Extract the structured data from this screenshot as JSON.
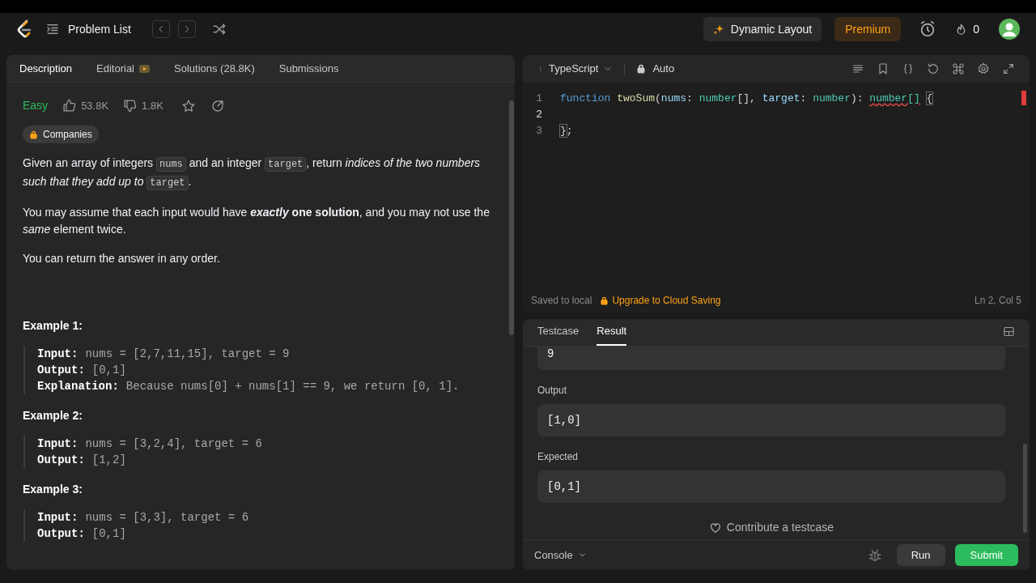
{
  "nav": {
    "title": "Problem List",
    "dynamic_layout": "Dynamic Layout",
    "premium": "Premium",
    "streak": "0"
  },
  "left_tabs": [
    {
      "label": "Description",
      "selected": true,
      "kind": "plain"
    },
    {
      "label": "Editorial",
      "selected": false,
      "kind": "video"
    },
    {
      "label": "Solutions (28.8K)",
      "selected": false,
      "kind": "plain"
    },
    {
      "label": "Submissions",
      "selected": false,
      "kind": "plain"
    }
  ],
  "problem": {
    "difficulty": "Easy",
    "likes": "53.8K",
    "dislikes": "1.8K",
    "companies": "Companies",
    "paragraphs": [
      [
        {
          "kind": "text",
          "text": "Given an array of integers "
        },
        {
          "kind": "code",
          "text": "nums"
        },
        {
          "kind": "text",
          "text": " and an integer "
        },
        {
          "kind": "code",
          "text": "target"
        },
        {
          "kind": "text",
          "text": ", return *indices of the two numbers such that they add up to* "
        },
        {
          "kind": "code",
          "text": "target"
        },
        {
          "kind": "text",
          "text": "."
        }
      ],
      [
        {
          "kind": "text",
          "text": "You may assume that each input would have ***exactly* one solution**, and you may not use the *same* element twice."
        }
      ],
      [
        {
          "kind": "text",
          "text": "You can return the answer in any order."
        }
      ]
    ],
    "examples": [
      {
        "title": "Example 1:",
        "lines": [
          {
            "label": "Input:",
            "value": "nums = [2,7,11,15], target = 9"
          },
          {
            "label": "Output:",
            "value": "[0,1]"
          },
          {
            "label": "Explanation:",
            "value": "Because nums[0] + nums[1] == 9, we return [0, 1]."
          }
        ]
      },
      {
        "title": "Example 2:",
        "lines": [
          {
            "label": "Input:",
            "value": "nums = [3,2,4], target = 6"
          },
          {
            "label": "Output:",
            "value": "[1,2]"
          }
        ]
      },
      {
        "title": "Example 3:",
        "lines": [
          {
            "label": "Input:",
            "value": "nums = [3,3], target = 6"
          },
          {
            "label": "Output:",
            "value": "[0,1]"
          }
        ]
      }
    ]
  },
  "editor": {
    "language": "TypeScript",
    "mode": "Auto",
    "lines": [
      {
        "number": "1",
        "tokens": [
          {
            "kind": "keyword",
            "text": "function"
          },
          {
            "kind": "function",
            "text": "twoSum"
          },
          {
            "kind": "plain",
            "text": "("
          },
          {
            "kind": "param",
            "text": "nums"
          },
          {
            "kind": "plain",
            "text": ": "
          },
          {
            "kind": "type",
            "text": "number"
          },
          {
            "kind": "plain",
            "text": "[], "
          },
          {
            "kind": "param",
            "text": "target"
          },
          {
            "kind": "plain",
            "text": ": "
          },
          {
            "kind": "type",
            "text": "number"
          },
          {
            "kind": "plain",
            "text": "): "
          },
          {
            "kind": "error",
            "text": "number[]"
          },
          {
            "kind": "bracket",
            "text": "{"
          }
        ]
      },
      {
        "number": "2"
      },
      {
        "number": "3",
        "tokens": [
          {
            "kind": "bracket",
            "text": "}"
          },
          {
            "kind": "plain",
            "text": ";"
          }
        ]
      }
    ],
    "saved": "Saved to local",
    "upgrade": "Upgrade to Cloud Saving",
    "cursor": "Ln 2, Col 5"
  },
  "bottom_tabs": [
    {
      "label": "Testcase",
      "selected": false
    },
    {
      "label": "Result",
      "selected": true
    }
  ],
  "result": {
    "partial_value": "9",
    "fields": [
      {
        "label": "Output",
        "value": "[1,0]"
      },
      {
        "label": "Expected",
        "value": "[0,1]"
      }
    ],
    "contribute": "Contribute a testcase"
  },
  "footer": {
    "console": "Console",
    "run": "Run",
    "submit": "Submit"
  }
}
